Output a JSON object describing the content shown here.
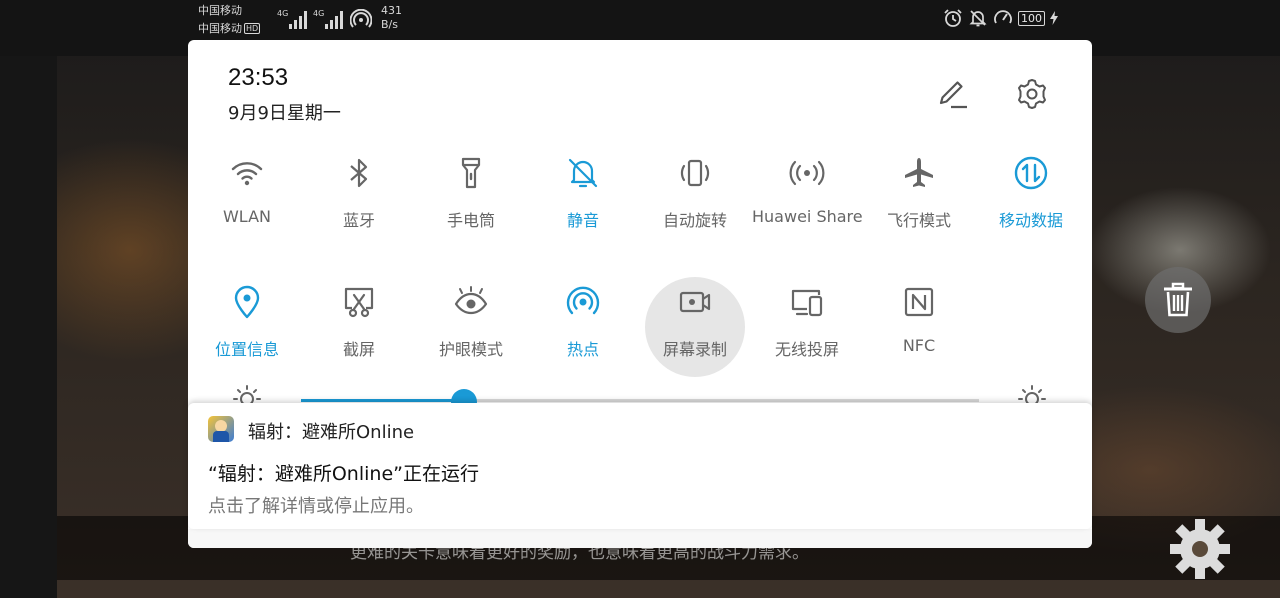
{
  "status_bar": {
    "carrier_1": "中国移动",
    "carrier_2": "中国移动",
    "hd_badge": "HD",
    "signal_1": "4G",
    "signal_2": "4G",
    "net_speed_value": "431",
    "net_speed_unit": "B/s",
    "battery": "100"
  },
  "panel": {
    "time": "23:53",
    "date": "9月9日星期一"
  },
  "tiles": [
    {
      "label": "WLAN",
      "icon": "wifi-icon",
      "active": false
    },
    {
      "label": "蓝牙",
      "icon": "bluetooth-icon",
      "active": false
    },
    {
      "label": "手电筒",
      "icon": "flashlight-icon",
      "active": false
    },
    {
      "label": "静音",
      "icon": "bell-off-icon",
      "active": true
    },
    {
      "label": "自动旋转",
      "icon": "auto-rotate-icon",
      "active": false
    },
    {
      "label": "Huawei Share",
      "icon": "huawei-share-icon",
      "active": false
    },
    {
      "label": "飞行模式",
      "icon": "airplane-icon",
      "active": false
    },
    {
      "label": "移动数据",
      "icon": "mobile-data-icon",
      "active": true
    },
    {
      "label": "位置信息",
      "icon": "location-icon",
      "active": true
    },
    {
      "label": "截屏",
      "icon": "screenshot-icon",
      "active": false
    },
    {
      "label": "护眼模式",
      "icon": "eye-comfort-icon",
      "active": false
    },
    {
      "label": "热点",
      "icon": "hotspot-icon",
      "active": true
    },
    {
      "label": "屏幕录制",
      "icon": "screen-record-icon",
      "active": false
    },
    {
      "label": "无线投屏",
      "icon": "wireless-projection-icon",
      "active": false
    },
    {
      "label": "NFC",
      "icon": "nfc-icon",
      "active": false
    }
  ],
  "brightness": {
    "level": 0.24
  },
  "notification": {
    "app_name": "辐射：避难所Online",
    "title": "“辐射：避难所Online”正在运行",
    "text": "点击了解详情或停止应用。"
  },
  "background": {
    "subtitle": "更难的关卡意味着更好的奖励，也意味着更高的战斗力需求。"
  },
  "colors": {
    "accent": "#1a9ad6",
    "icon_inactive": "#666666"
  }
}
